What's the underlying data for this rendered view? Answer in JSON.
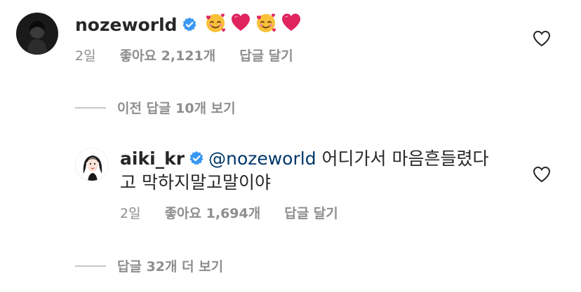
{
  "comments": [
    {
      "username": "nozeworld",
      "verified": true,
      "text": "",
      "emojis": [
        "smiling-face-with-hearts",
        "red-heart",
        "smiling-face-with-hearts",
        "red-heart"
      ],
      "time": "2일",
      "likes": "좋아요 2,121개",
      "reply": "답글 달기"
    },
    {
      "username": "aiki_kr",
      "verified": true,
      "mention": "@nozeworld",
      "text_line1": "어디가서 마음흔들렸다",
      "text_line2": "고 막하지말고말이야",
      "time": "2일",
      "likes": "좋아요 1,694개",
      "reply": "답글 달기"
    }
  ],
  "view_previous_replies": "이전 답글 10개 보기",
  "view_more_replies": "답글 32개 더 보기",
  "colors": {
    "text": "#262626",
    "muted": "#8e8e8e",
    "mention": "#00376b",
    "verified": "#3897f0",
    "heart_emoji": "#e0245e"
  }
}
